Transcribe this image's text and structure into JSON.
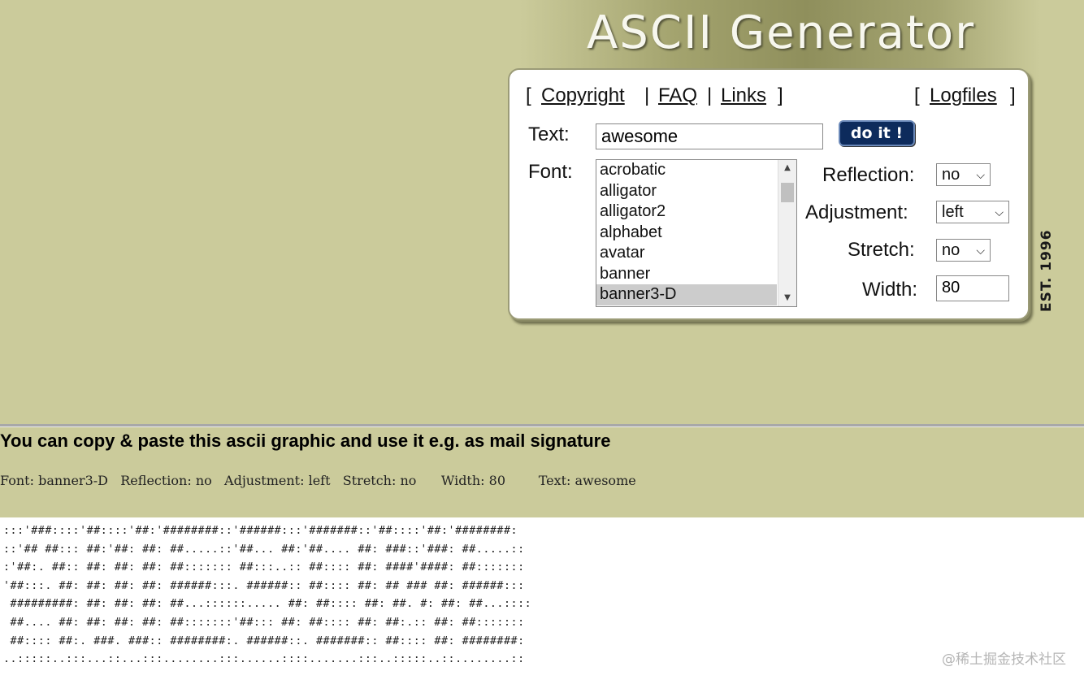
{
  "header": {
    "logo": "ASCII Generator",
    "est": "EST. 1996"
  },
  "nav": {
    "open": "[",
    "sep": "|",
    "close": "]",
    "copyright": "Copyright",
    "faq": "FAQ",
    "links": "Links",
    "logfiles": "Logfiles"
  },
  "form": {
    "text_label": "Text:",
    "text_value": "awesome",
    "do_it": "do it !",
    "font_label": "Font:",
    "fonts": [
      "acrobatic",
      "alligator",
      "alligator2",
      "alphabet",
      "avatar",
      "banner",
      "banner3-D"
    ],
    "selected_font": "banner3-D",
    "reflection_label": "Reflection:",
    "reflection_value": "no",
    "adjustment_label": "Adjustment:",
    "adjustment_value": "left",
    "stretch_label": "Stretch:",
    "stretch_value": "no",
    "width_label": "Width:",
    "width_value": "80"
  },
  "result": {
    "heading": "You can copy & paste this ascii graphic and use it e.g. as mail signature",
    "meta": "Font: banner3-D   Reflection: no   Adjustment: left   Stretch: no      Width: 80        Text: awesome",
    "ascii": [
      ":::'###::::'##::::'##:'########::'######:::'#######::'##::::'##:'########:",
      "::'## ##::: ##:'##: ##: ##.....::'##... ##:'##.... ##: ###::'###: ##.....::",
      ":'##:. ##:: ##: ##: ##: ##::::::: ##:::..:: ##:::: ##: ####'####: ##:::::::",
      "'##:::. ##: ##: ##: ##: ######:::. ######:: ##:::: ##: ## ### ##: ######:::",
      " #########: ##: ##: ##: ##...::::::..... ##: ##:::: ##: ##. #: ##: ##...::::",
      " ##.... ##: ##: ##: ##: ##:::::::'##::: ##: ##:::: ##: ##:.:: ##: ##:::::::",
      " ##:::: ##:. ###. ###:: ########:. ######::. #######:: ##:::: ##: ########:",
      "..:::::..:::...::...:::........:::......::::.......:::..:::::..::........::"
    ],
    "watermark": "@稀土掘金技术社区"
  }
}
